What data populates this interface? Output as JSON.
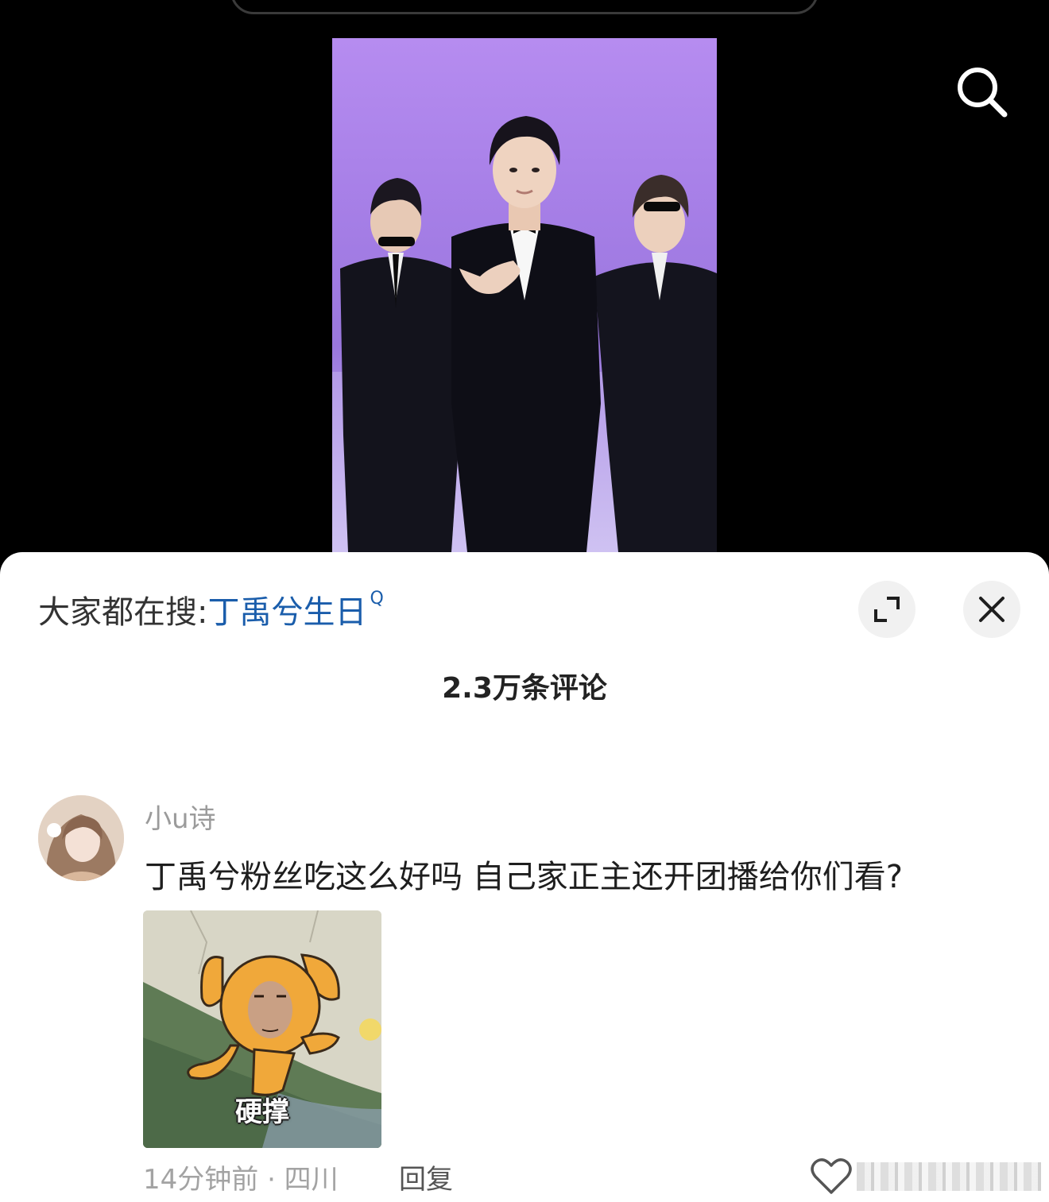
{
  "hot_search": {
    "prefix": "大家都在搜:",
    "term": "丁禹兮生日",
    "search_mark": "Q"
  },
  "comments_header": {
    "count_label": "2.3万条评论"
  },
  "comment": {
    "username": "小u诗",
    "text": "丁禹兮粉丝吃这么好吗 自己家正主还开团播给你们看?",
    "sticker_caption": "硬撑",
    "time_location": "14分钟前 · 四川",
    "reply_label": "回复"
  },
  "icons": [
    "search-icon",
    "expand-icon",
    "close-icon",
    "heart-icon"
  ],
  "colors": {
    "link_blue": "#1a5dab",
    "video_bg": "#000000",
    "sheet_bg": "#ffffff",
    "stage_purple": "#a57ee6"
  }
}
